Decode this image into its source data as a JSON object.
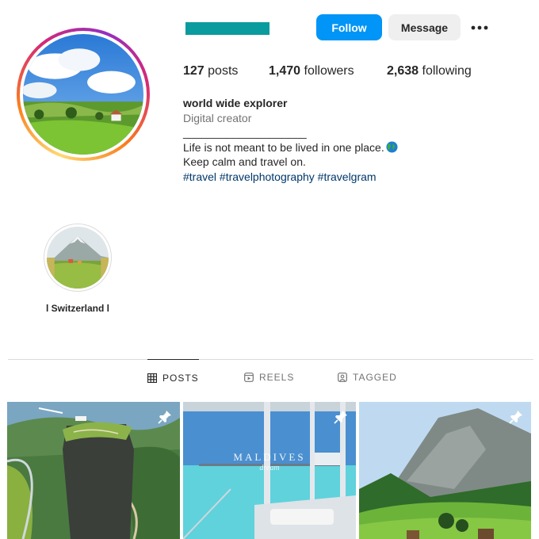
{
  "header": {
    "follow_label": "Follow",
    "message_label": "Message",
    "accent_color": "#0095f6",
    "username_redaction_color": "#0a9b9e"
  },
  "stats": {
    "posts_count": "127",
    "posts_label": "posts",
    "followers_count": "1,470",
    "followers_label": "followers",
    "following_count": "2,638",
    "following_label": "following"
  },
  "bio": {
    "name": "world wide explorer",
    "category": "Digital creator",
    "divider_line": "____________________",
    "line1": "Life is not meant to be lived in one place.",
    "line1_icon": "globe-icon",
    "line2": "Keep calm and travel on.",
    "hashtags": "#travel #travelphotography #travelgram"
  },
  "highlights": [
    {
      "label": "l Switzerland l"
    }
  ],
  "tabs": [
    {
      "label": "POSTS",
      "icon": "grid-icon",
      "active": true
    },
    {
      "label": "REELS",
      "icon": "reels-icon",
      "active": false
    },
    {
      "label": "TAGGED",
      "icon": "tagged-icon",
      "active": false
    }
  ],
  "posts": [
    {
      "icon": "pin-icon"
    },
    {
      "icon": "pin-icon",
      "overlay_title": "MALDIVES",
      "overlay_sub": "dream"
    },
    {
      "icon": "pin-icon"
    }
  ]
}
